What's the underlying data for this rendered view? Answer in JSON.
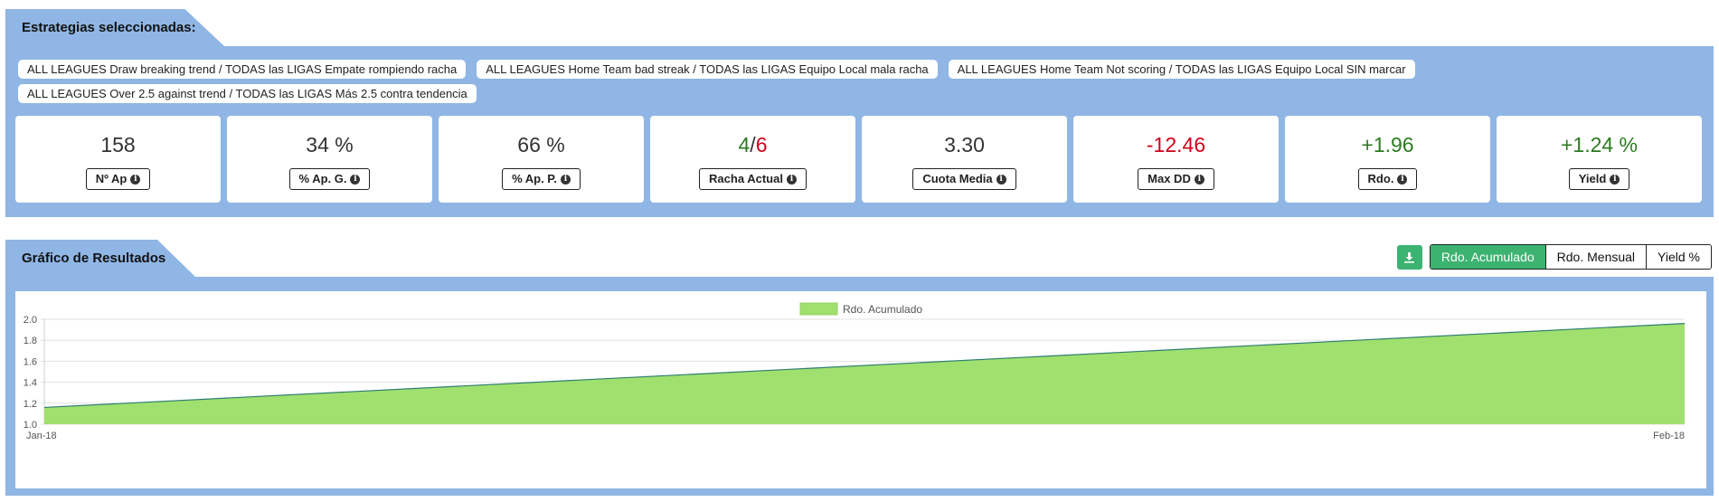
{
  "strategies": {
    "title": "Estrategias seleccionadas:",
    "items": [
      "ALL LEAGUES Draw breaking trend / TODAS las LIGAS Empate rompiendo racha",
      "ALL LEAGUES Home Team bad streak / TODAS las LIGAS Equipo Local mala racha",
      "ALL LEAGUES Home Team Not scoring / TODAS las LIGAS Equipo Local SIN marcar",
      "ALL LEAGUES Over 2.5 against trend / TODAS las LIGAS Más 2.5 contra tendencia"
    ]
  },
  "kpis": {
    "ap": {
      "value": "158",
      "label": "Nº Ap"
    },
    "ap_g": {
      "value": "34 %",
      "label": "% Ap. G."
    },
    "ap_p": {
      "value": "66 %",
      "label": "% Ap. P."
    },
    "racha": {
      "wins": "4",
      "sep": "/",
      "losses": "6",
      "label": "Racha Actual"
    },
    "cuota": {
      "value": "3.30",
      "label": "Cuota Media"
    },
    "maxdd": {
      "value": "-12.46",
      "label": "Max DD"
    },
    "rdo": {
      "value": "+1.96",
      "label": "Rdo."
    },
    "yield": {
      "value": "+1.24 %",
      "label": "Yield"
    }
  },
  "results": {
    "title": "Gráfico de Resultados",
    "tabs": [
      "Rdo. Acumulado",
      "Rdo. Mensual",
      "Yield %"
    ],
    "active_tab": "Rdo. Acumulado",
    "download_icon": "download-icon"
  },
  "colors": {
    "panel": "#8fb6e4",
    "accent": "#3cb371",
    "positive": "#2d7a22",
    "negative": "#d0021b",
    "area_fill": "#a0e06e",
    "area_line": "#2e7d72"
  },
  "chart_data": {
    "type": "area",
    "x": [
      "Jan-18",
      "Feb-18"
    ],
    "series": [
      {
        "name": "Rdo. Acumulado",
        "values": [
          1.16,
          1.96
        ]
      }
    ],
    "ylim": [
      1.0,
      2.0
    ],
    "yticks": [
      "1.0",
      "1.2",
      "1.4",
      "1.6",
      "1.8",
      "2.0"
    ],
    "legend": "top-center",
    "grid": true
  }
}
